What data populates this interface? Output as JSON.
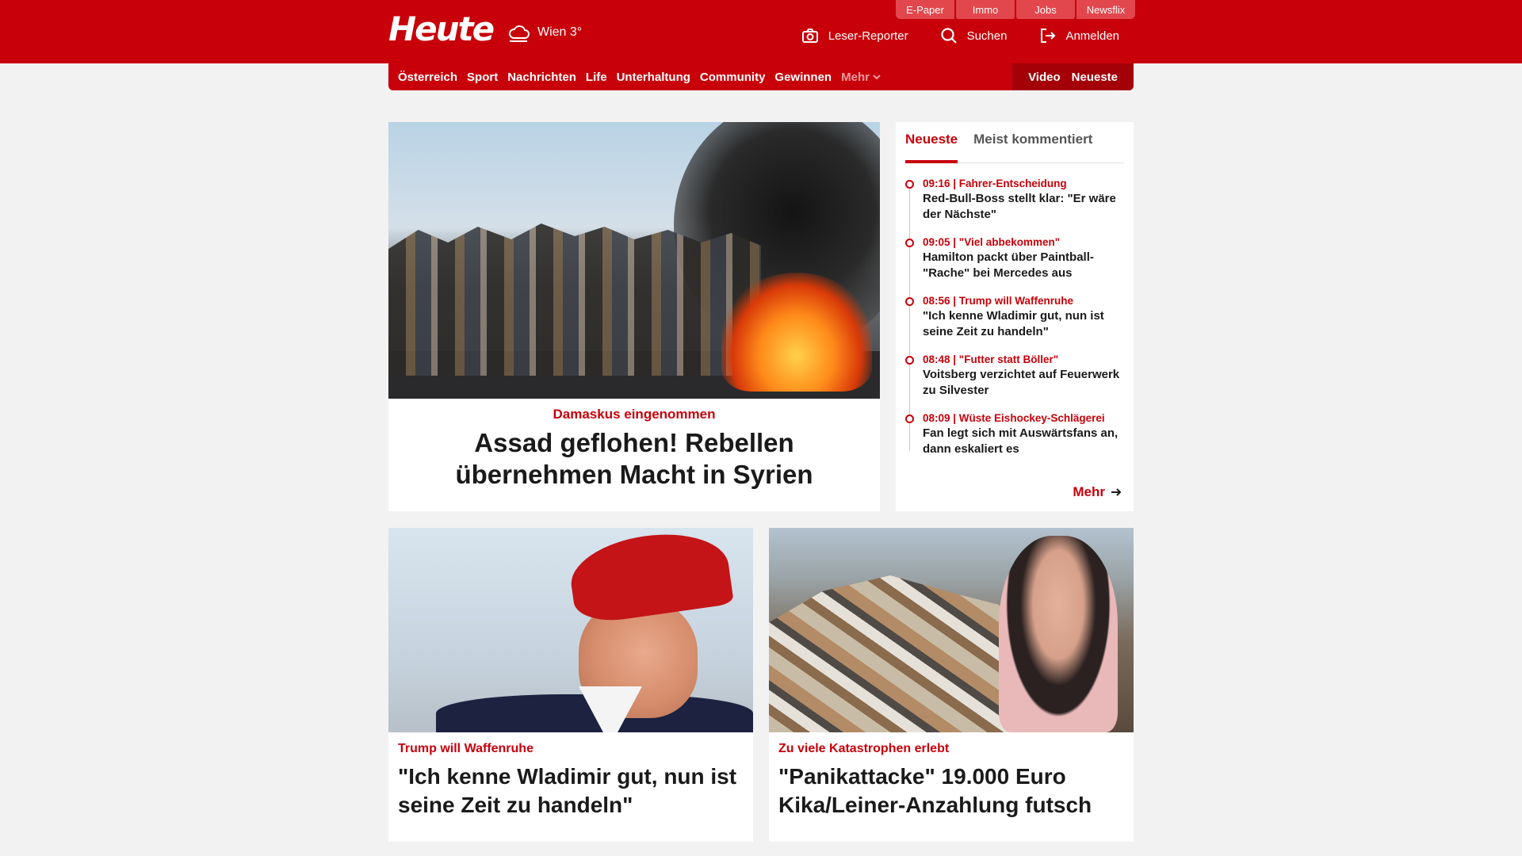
{
  "header": {
    "logo": "Heute",
    "weather": "Wien 3°",
    "service_tabs": [
      "E-Paper",
      "Immo",
      "Jobs",
      "Newsflix"
    ],
    "actions": {
      "reporter": "Leser-Reporter",
      "search": "Suchen",
      "login": "Anmelden"
    }
  },
  "nav": {
    "items": [
      "Österreich",
      "Sport",
      "Nachrichten",
      "Life",
      "Unterhaltung",
      "Community",
      "Gewinnen"
    ],
    "more": "Mehr",
    "video": "Video",
    "latest": "Neueste"
  },
  "hero": {
    "kicker": "Damaskus eingenommen",
    "title": "Assad geflohen! Rebellen übernehmen Macht in Syrien"
  },
  "latest_panel": {
    "tabs": [
      "Neueste",
      "Meist kommentiert"
    ],
    "items": [
      {
        "meta": "09:16 | Fahrer-Entscheidung",
        "title": "Red-Bull-Boss stellt klar: \"Er wäre der Nächste\""
      },
      {
        "meta": "09:05 | \"Viel abbekommen\"",
        "title": "Hamilton packt über Paintball-\"Rache\" bei Mercedes aus"
      },
      {
        "meta": "08:56 | Trump will Waffenruhe",
        "title": "\"Ich kenne Wladimir gut, nun ist seine Zeit zu handeln\""
      },
      {
        "meta": "08:48 | \"Futter statt Böller\"",
        "title": "Voitsberg verzichtet auf Feuerwerk zu Silvester"
      },
      {
        "meta": "08:09 | Wüste Eishockey-Schlägerei",
        "title": "Fan legt sich mit Auswärtsfans an, dann eskaliert es"
      }
    ],
    "more": "Mehr"
  },
  "cards": [
    {
      "kicker": "Trump will Waffenruhe",
      "title": "\"Ich kenne Wladimir gut, nun ist seine Zeit zu handeln\""
    },
    {
      "kicker": "Zu viele Katastrophen erlebt",
      "title": "\"Panikattacke\" 19.000 Euro Kika/Leiner-Anzahlung futsch"
    }
  ],
  "colors": {
    "brand_red": "#c8000a",
    "background": "#f2f2f2"
  }
}
